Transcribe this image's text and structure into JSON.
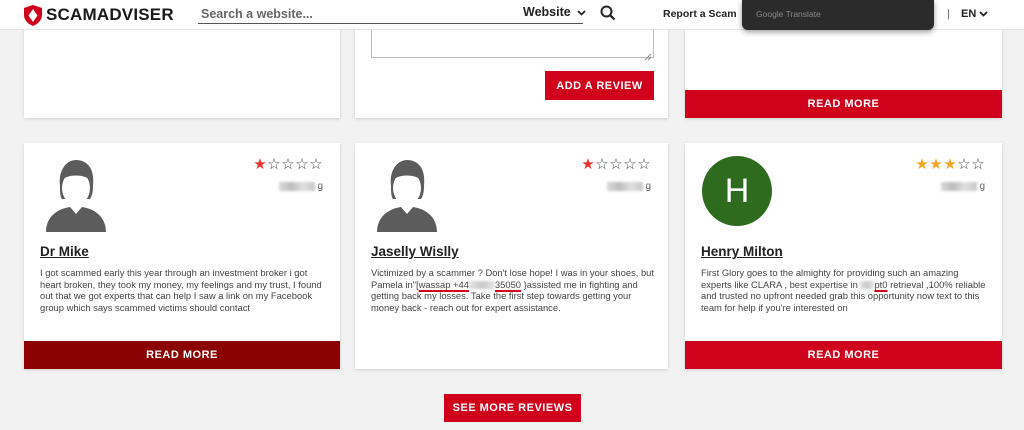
{
  "header": {
    "logo_text": "SCAMADVISER",
    "search_placeholder": "Search a website...",
    "search_type": "Website",
    "report_link": "Report a Scam",
    "google_translate": "Google Translate",
    "separator": "|",
    "language": "EN"
  },
  "top_cards": {
    "add_review_label": "ADD A REVIEW",
    "read_more_label": "READ MORE"
  },
  "reviews": [
    {
      "name": "Dr Mike",
      "rating": 1,
      "date_suffix": "g",
      "text": "I got scammed early this year through an investment broker i got heart broken, they took my money, my feelings and my trust, I found out that we got experts that can help I saw a link on my Facebook group which says scammed victims should contact",
      "read_more": "READ MORE"
    },
    {
      "name": "Jaselly Wislly",
      "rating": 1,
      "date_suffix": "g",
      "text_before": "Victimized by a scammer ? Don't lose hope! I was in your shoes, but Pamela in\"[",
      "text_highlight_a": "wassap +44",
      "text_highlight_b": "35050",
      "text_after": " }assisted me in fighting and getting back my losses. Take the first step towards getting your money back - reach out for expert assistance."
    },
    {
      "name": "Henry Milton",
      "avatar_letter": "H",
      "rating": 3,
      "date_suffix": "g",
      "text_before": "First Glory goes to the almighty for providing such an amazing experts like CLARA , best expertise in ",
      "text_highlight": "pt0",
      "text_after": " retrieval ,100% reliable and trusted no upfront needed grab this opportunity now text to this team for help if you're interested on",
      "read_more": "READ MORE"
    }
  ],
  "see_more_label": "SEE MORE REVIEWS",
  "colors": {
    "brand_red": "#d0021b",
    "dark_red": "#8b0000",
    "star_red": "#e8312f",
    "star_gold": "#f5a623",
    "avatar_green": "#2e6b1e"
  }
}
